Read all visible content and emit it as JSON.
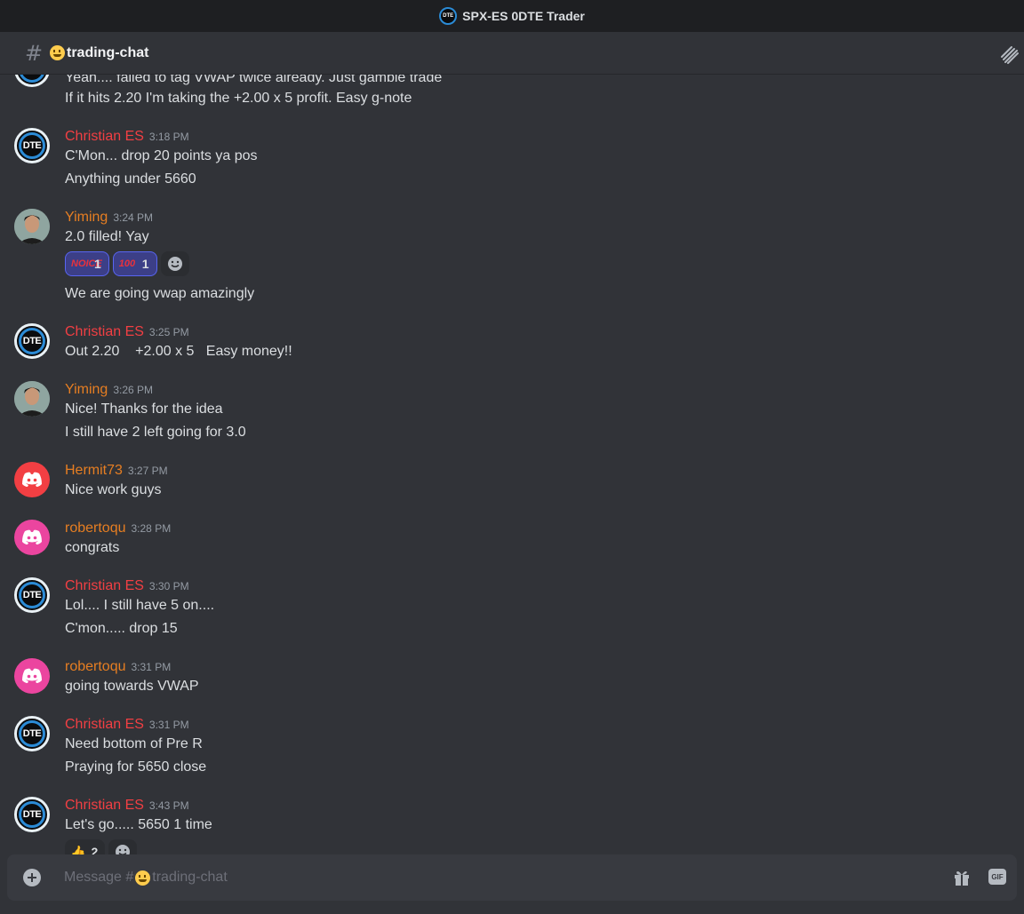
{
  "window": {
    "title": "SPX-ES 0DTE Trader",
    "logo_text": "DTE"
  },
  "channel": {
    "name": "trading-chat",
    "hash": "#",
    "emoji": "grinning-face-emoji"
  },
  "colors": {
    "christian": "#f23f43",
    "yiming": "#e67e22",
    "hermit": "#e67e22",
    "roberto": "#e67e22",
    "timestamp": "#949ba4"
  },
  "messages": {
    "g0": {
      "line1": "Yeah.... failed to tag VWAP twice already. Just gamble trade",
      "line2": "If it hits 2.20 I'm taking the +2.00 x 5 profit. Easy g-note"
    },
    "g1": {
      "author": "Christian ES",
      "time": "3:18 PM",
      "line1": "C'Mon... drop 20 points ya pos",
      "line2": "Anything under 5660"
    },
    "g2": {
      "author": "Yiming",
      "time": "3:24 PM",
      "line1": "2.0 filled! Yay",
      "reactions": [
        {
          "emoji": "noice-emoji",
          "count": "1"
        },
        {
          "emoji": "hundred-points-emoji",
          "count": "1"
        }
      ],
      "line2": "We are going vwap amazingly"
    },
    "g3": {
      "author": "Christian ES",
      "time": "3:25 PM",
      "line1": "Out 2.20    +2.00 x 5   Easy money!!"
    },
    "g4": {
      "author": "Yiming",
      "time": "3:26 PM",
      "line1": "Nice! Thanks for the idea",
      "line2": "I still have 2 left going for 3.0"
    },
    "g5": {
      "author": "Hermit73",
      "time": "3:27 PM",
      "line1": "Nice work guys"
    },
    "g6": {
      "author": "robertoqu",
      "time": "3:28 PM",
      "line1": "congrats"
    },
    "g7": {
      "author": "Christian ES",
      "time": "3:30 PM",
      "line1": "Lol.... I still have 5 on....",
      "line2": "C'mon..... drop 15"
    },
    "g8": {
      "author": "robertoqu",
      "time": "3:31 PM",
      "line1": "going towards VWAP"
    },
    "g9": {
      "author": "Christian ES",
      "time": "3:31 PM",
      "line1": "Need bottom of Pre R",
      "line2": "Praying for 5650 close"
    },
    "g10": {
      "author": "Christian ES",
      "time": "3:43 PM",
      "line1": "Let's go..... 5650 1 time",
      "reactions": [
        {
          "emoji": "thumbs-up-emoji",
          "count": "2"
        }
      ]
    }
  },
  "composer": {
    "placeholder_prefix": "Message #",
    "placeholder_channel": "trading-chat",
    "gif_label": "GIF"
  }
}
